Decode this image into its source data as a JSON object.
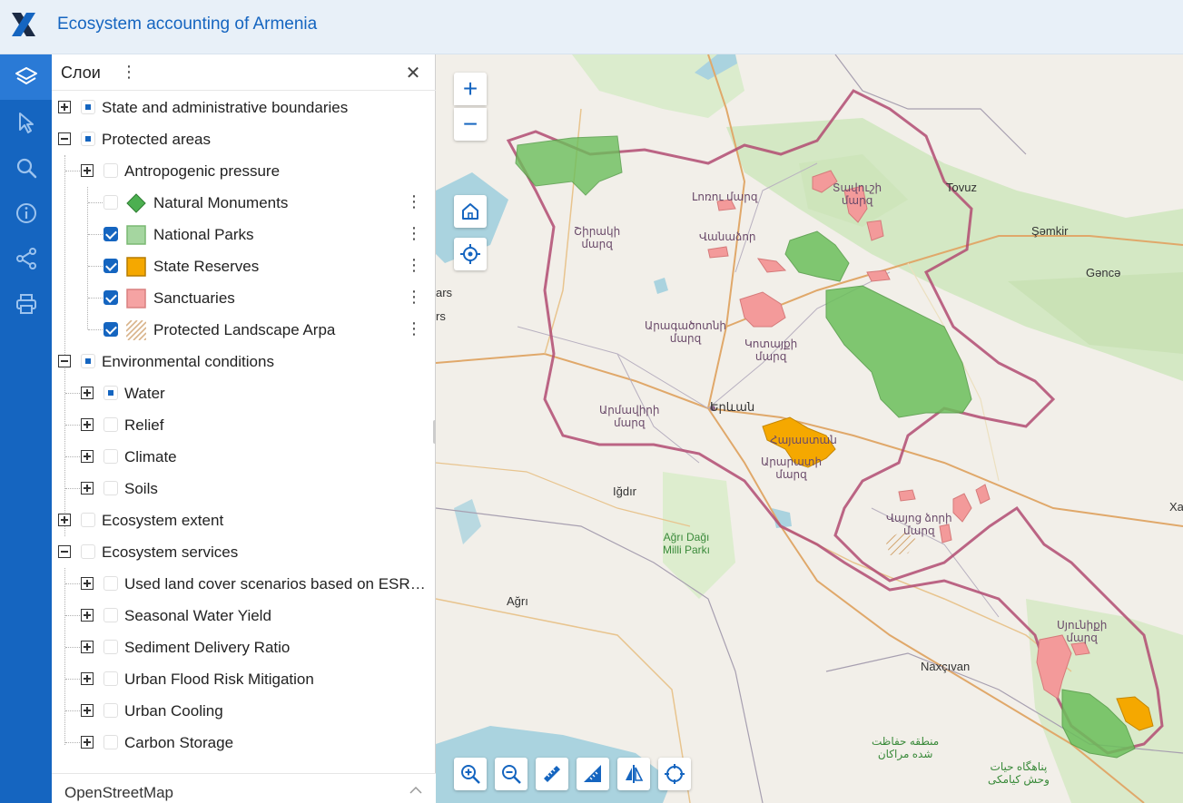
{
  "app": {
    "title": "Ecosystem accounting of Armenia"
  },
  "toolbar": {
    "items": [
      {
        "name": "layers-icon",
        "active": true
      },
      {
        "name": "select-icon",
        "active": false
      },
      {
        "name": "search-icon",
        "active": false
      },
      {
        "name": "info-icon",
        "active": false
      },
      {
        "name": "share-icon",
        "active": false
      },
      {
        "name": "print-icon",
        "active": false
      }
    ]
  },
  "panel": {
    "title": "Слои",
    "menu_glyph": "⋮",
    "close_glyph": "✕",
    "layers": [
      {
        "label": "State and administrative boundaries",
        "level": 0,
        "expander": "plus",
        "check": "partial"
      },
      {
        "label": "Protected areas",
        "level": 0,
        "expander": "minus",
        "check": "partial"
      },
      {
        "label": "Antropogenic pressure",
        "level": 1,
        "expander": "plus",
        "check": "empty"
      },
      {
        "label": "Natural Monuments",
        "level": 2,
        "check": "empty",
        "swatch": "diamond",
        "kebab": "⋮"
      },
      {
        "label": "National Parks",
        "level": 2,
        "check": "checked",
        "swatch": "green",
        "kebab": "⋮"
      },
      {
        "label": "State Reserves",
        "level": 2,
        "check": "checked",
        "swatch": "orange",
        "kebab": "⋮"
      },
      {
        "label": "Sanctuaries",
        "level": 2,
        "check": "checked",
        "swatch": "pink",
        "kebab": "⋮"
      },
      {
        "label": "Protected Landscape Arpa",
        "level": 2,
        "check": "checked",
        "swatch": "hatch",
        "kebab": "⋮"
      },
      {
        "label": "Environmental conditions",
        "level": 0,
        "expander": "minus",
        "check": "partial"
      },
      {
        "label": "Water",
        "level": 1,
        "expander": "plus",
        "check": "partial"
      },
      {
        "label": "Relief",
        "level": 1,
        "expander": "plus",
        "check": "empty"
      },
      {
        "label": "Climate",
        "level": 1,
        "expander": "plus",
        "check": "empty"
      },
      {
        "label": "Soils",
        "level": 1,
        "expander": "plus",
        "check": "empty"
      },
      {
        "label": "Ecosystem extent",
        "level": 0,
        "expander": "plus",
        "check": "empty"
      },
      {
        "label": "Ecosystem services",
        "level": 0,
        "expander": "minus",
        "check": "empty"
      },
      {
        "label": "Used land cover scenarios based on ESRI...",
        "level": 1,
        "expander": "plus",
        "check": "empty"
      },
      {
        "label": "Seasonal Water Yield",
        "level": 1,
        "expander": "plus",
        "check": "empty"
      },
      {
        "label": "Sediment Delivery Ratio",
        "level": 1,
        "expander": "plus",
        "check": "empty"
      },
      {
        "label": "Urban Flood Risk Mitigation",
        "level": 1,
        "expander": "plus",
        "check": "empty"
      },
      {
        "label": "Urban Cooling",
        "level": 1,
        "expander": "plus",
        "check": "empty"
      },
      {
        "label": "Carbon Storage",
        "level": 1,
        "expander": "plus",
        "check": "empty"
      }
    ],
    "basemap": "OpenStreetMap"
  },
  "map": {
    "zoom_in": "+",
    "zoom_out": "−",
    "labels": [
      {
        "text": "Tovuz",
        "cls": "dark"
      },
      {
        "text": "Şəmkir",
        "cls": "dark"
      },
      {
        "text": "Gəncə",
        "cls": "dark"
      },
      {
        "text": "Տավուշի\nմարզ",
        "cls": ""
      },
      {
        "text": "Լոռու մարզ",
        "cls": ""
      },
      {
        "text": "Շիրակի\nմարզ",
        "cls": ""
      },
      {
        "text": "Վանաձոր",
        "cls": ""
      },
      {
        "text": "Արագածոտնի\nմարզ",
        "cls": ""
      },
      {
        "text": "Կոտայքի\nմարզ",
        "cls": ""
      },
      {
        "text": "Արմավիրի\nմարզ",
        "cls": ""
      },
      {
        "text": "Երևան",
        "cls": "dark"
      },
      {
        "text": "Հայաստան",
        "cls": ""
      },
      {
        "text": "Արարատի\nմարզ",
        "cls": ""
      },
      {
        "text": "Iğdır",
        "cls": "dark"
      },
      {
        "text": "Ağrı Dağı\nMilli Parkı",
        "cls": "green"
      },
      {
        "text": "Վայոց ձորի\nմարզ",
        "cls": ""
      },
      {
        "text": "Ağrı",
        "cls": "dark"
      },
      {
        "text": "Սյունիքի\nմարզ",
        "cls": ""
      },
      {
        "text": "Naxçıvan",
        "cls": "dark"
      },
      {
        "text": "منطقه حفاظت\nشده مراکان",
        "cls": "green"
      },
      {
        "text": "پناهگاه حیات\nوحش کیامکی",
        "cls": "green"
      },
      {
        "text": "ars",
        "cls": "dark"
      },
      {
        "text": "rs",
        "cls": "dark"
      },
      {
        "text": "Xa",
        "cls": "dark"
      }
    ],
    "bottom_tools": [
      "zoom-in-tool-icon",
      "zoom-out-tool-icon",
      "measure-distance-icon",
      "measure-area-icon",
      "compare-icon",
      "locate-icon"
    ]
  },
  "colors": {
    "primary": "#1565c0",
    "national_park": "#6cbf5c",
    "state_reserve": "#f5a800",
    "sanctuary": "#f39a9a",
    "border": "#b4506e"
  }
}
